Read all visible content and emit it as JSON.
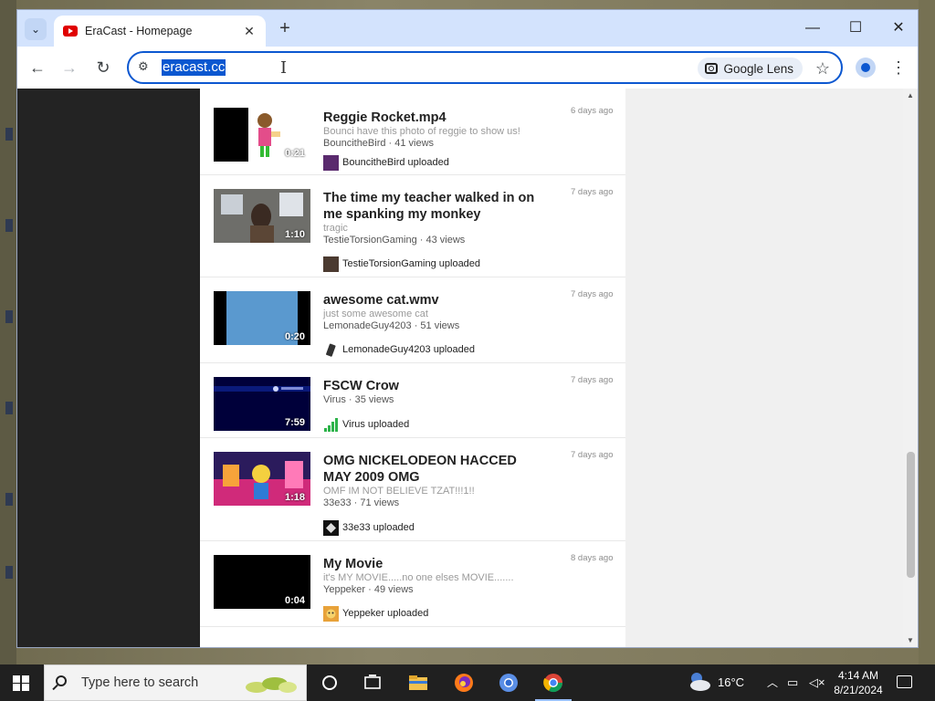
{
  "browser": {
    "tab_title": "EraCast - Homepage",
    "url": "eracast.cc",
    "lens_label": "Google Lens",
    "new_tab_glyph": "+",
    "tab_close_glyph": "✕"
  },
  "videos": [
    {
      "title": "Reggie Rocket.mp4",
      "description": "Bounci have this photo of reggie to show us!",
      "meta": "BouncitheBird · 41 views",
      "date": "6 days ago",
      "duration": "0:21",
      "uploader_text": "BouncitheBird uploaded"
    },
    {
      "title": "The time my teacher walked in on me spanking my monkey",
      "description": "tragic",
      "meta": "TestieTorsionGaming · 43 views",
      "date": "7 days ago",
      "duration": "1:10",
      "uploader_text": "TestieTorsionGaming uploaded"
    },
    {
      "title": "awesome cat.wmv",
      "description": "just some awesome cat",
      "meta": "LemonadeGuy4203 · 51 views",
      "date": "7 days ago",
      "duration": "0:20",
      "uploader_text": "LemonadeGuy4203 uploaded"
    },
    {
      "title": "FSCW Crow",
      "description": "",
      "meta": "Virus · 35 views",
      "date": "7 days ago",
      "duration": "7:59",
      "uploader_text": "Virus uploaded"
    },
    {
      "title": "OMG NICKELODEON HACCED MAY 2009 OMG",
      "description": "OMF IM NOT BELIEVE TZAT!!!1!!",
      "meta": "33e33 · 71 views",
      "date": "7 days ago",
      "duration": "1:18",
      "uploader_text": "33e33 uploaded"
    },
    {
      "title": "My Movie",
      "description": "it's MY MOVIE.....no one elses MOVIE.......",
      "meta": "Yeppeker · 49 views",
      "date": "8 days ago",
      "duration": "0:04",
      "uploader_text": "Yeppeker uploaded"
    }
  ],
  "taskbar": {
    "search_placeholder": "Type here to search",
    "weather": "16°C",
    "time": "4:14 AM",
    "date": "8/21/2024"
  },
  "colors": {
    "accent": "#0b57d0",
    "tab_strip": "#d3e3fd",
    "taskbar": "#202020",
    "dark_panel": "#232323"
  }
}
